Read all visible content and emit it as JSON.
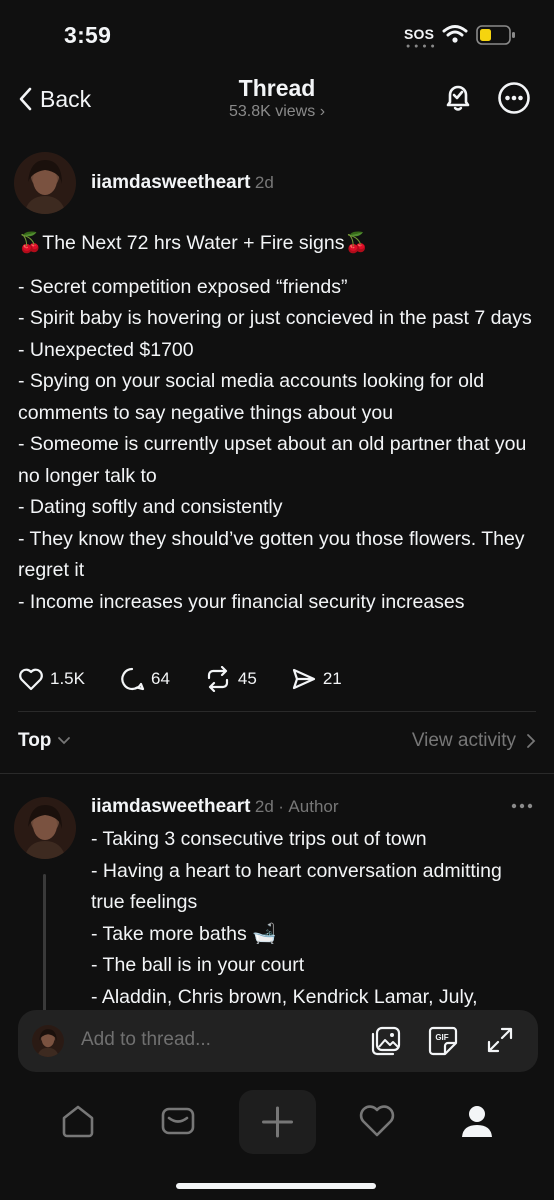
{
  "status": {
    "time": "3:59",
    "sos": "SOS"
  },
  "nav": {
    "back_label": "Back",
    "title": "Thread",
    "views": "53.8K views"
  },
  "post": {
    "username": "iiamdasweetheart",
    "time": "2d",
    "lines": [
      "🍒The Next 72 hrs Water + Fire signs🍒",
      "- Secret competition exposed “friends”",
      "- Spirit baby is hovering or just concieved in the past 7 days",
      "- Unexpected $1700",
      "- Spying on your social media accounts looking for old comments to say negative things about you",
      "- Someome is currently upset about an old partner that you no longer talk to",
      "- Dating softly and consistently",
      "- They know they should’ve gotten you those flowers. They regret it",
      "- Income increases your financial security increases"
    ],
    "likes": "1.5K",
    "replies": "64",
    "reposts": "45",
    "shares": "21"
  },
  "sort": {
    "label": "Top",
    "view_activity": "View activity"
  },
  "reply": {
    "username": "iiamdasweetheart",
    "time": "2d",
    "role": "Author",
    "lines": [
      "- Taking 3 consecutive trips out of town",
      "- Having a heart to heart conversation admitting true feelings",
      "- Take more baths 🛁",
      "- The ball is in your court",
      "- Aladdin, Chris brown, Kendrick Lamar, July,"
    ]
  },
  "composer": {
    "placeholder": "Add to thread...",
    "gif_label": "GIF"
  }
}
